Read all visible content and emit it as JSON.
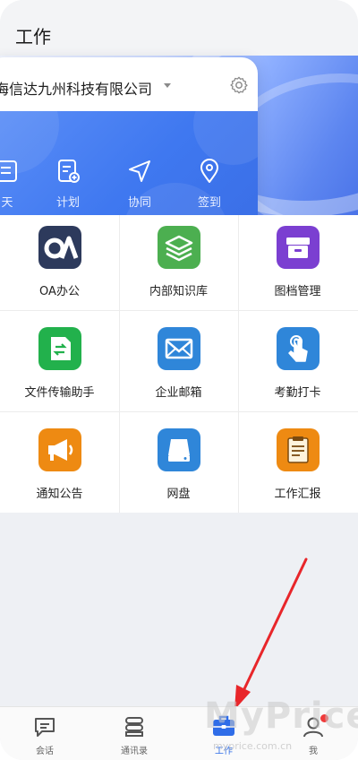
{
  "header": {
    "title": "工作"
  },
  "company": {
    "name": "海信达九州科技有限公司",
    "settings_icon": "gear-icon"
  },
  "quick_actions": [
    {
      "label": "天",
      "icon": "chat-doc-icon"
    },
    {
      "label": "计划",
      "icon": "plan-add-icon"
    },
    {
      "label": "协同",
      "icon": "navigation-arrow-icon"
    },
    {
      "label": "签到",
      "icon": "location-pin-icon"
    }
  ],
  "apps": [
    {
      "label": "OA办公",
      "icon": "oa-icon",
      "color": "#2d3a5c"
    },
    {
      "label": "内部知识库",
      "icon": "layers-icon",
      "color": "#4caf50"
    },
    {
      "label": "图档管理",
      "icon": "archive-box-icon",
      "color": "#7b3fd1"
    },
    {
      "label": "文件传输助手",
      "icon": "file-transfer-icon",
      "color": "#22b14c"
    },
    {
      "label": "企业邮箱",
      "icon": "mail-icon",
      "color": "#2f86d9"
    },
    {
      "label": "考勤打卡",
      "icon": "tap-hand-icon",
      "color": "#2f86d9"
    },
    {
      "label": "通知公告",
      "icon": "megaphone-icon",
      "color": "#ee8a12"
    },
    {
      "label": "网盘",
      "icon": "drive-icon",
      "color": "#2f86d9"
    },
    {
      "label": "工作汇报",
      "icon": "report-doc-icon",
      "color": "#ee8a12"
    }
  ],
  "tabbar": {
    "tabs": [
      {
        "label": "会话",
        "icon": "chat-icon",
        "active": false
      },
      {
        "label": "通讯录",
        "icon": "contacts-icon",
        "active": false
      },
      {
        "label": "工作",
        "icon": "briefcase-icon",
        "active": true
      },
      {
        "label": "我",
        "icon": "user-icon",
        "active": false
      }
    ],
    "accent": "#2f6de8"
  },
  "watermark": {
    "text": "MyPrice",
    "sub": "myprice.com.cn"
  }
}
